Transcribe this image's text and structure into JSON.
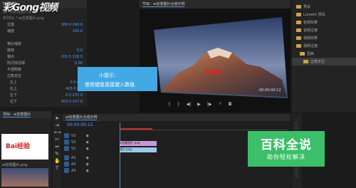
{
  "watermark": {
    "text": "彩Gong视频"
  },
  "effect_controls": {
    "tab_label": "效果控件",
    "source": "源：ai创意图片.png",
    "header": "序列01 * ai创意图片.png",
    "rows": [
      {
        "label": "位置",
        "value": "360.0 240.0"
      },
      {
        "label": "缩放",
        "value": "100.0"
      },
      {
        "label": "",
        "value": ""
      },
      {
        "label": "等比缩放",
        "value": ""
      },
      {
        "label": "旋转",
        "value": "0.0"
      },
      {
        "label": "锚点",
        "value": "201.5 118.5"
      },
      {
        "label": "防闪烁滤镜",
        "value": "0.00"
      },
      {
        "label": "不透明度",
        "value": ""
      },
      {
        "label": "边角定位",
        "value": ""
      },
      {
        "label": "左上",
        "value": "0.0 0.0"
      },
      {
        "label": "右上",
        "value": "403.0 0.0"
      },
      {
        "label": "左下",
        "value": "0.0 237.0"
      },
      {
        "label": "右下",
        "value": "403.0 237.0"
      }
    ]
  },
  "program": {
    "tab_label": "节目：ai创意图片合成示例",
    "timecode": "00:00:00:12",
    "logo_text": "Bai度"
  },
  "hint_box": {
    "title": "小提示：",
    "text": "使用键盘直接键入数值"
  },
  "effects_panel": {
    "items": [
      "预设",
      "Lumetri 预设",
      "音频效果",
      "音频过渡",
      "视频效果",
      "视频过渡",
      "扭曲",
      "边角定位"
    ]
  },
  "project": {
    "tab_label": "项目：ai创意图片",
    "filename": "ai创意图片.png",
    "logo_text": "Bai经验"
  },
  "timeline": {
    "tab_label": "ai创意图片合成示例",
    "timecode": "00:00:00:12",
    "tracks": [
      "V3",
      "V2",
      "V1",
      "A1",
      "A2",
      "A3"
    ],
    "clips": [
      {
        "label": "ai创意图片.png"
      },
      {
        "label": "图片.png"
      }
    ]
  },
  "brand": {
    "title": "百科全说",
    "subtitle": "助你轻松解决"
  }
}
